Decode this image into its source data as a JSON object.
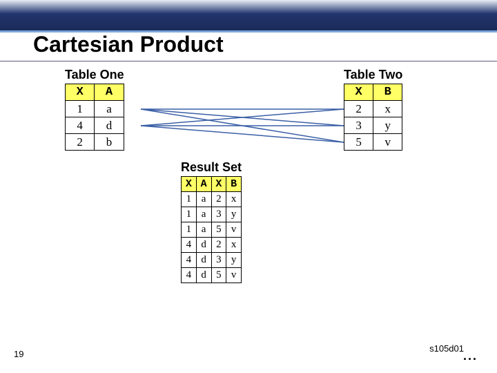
{
  "title": "Cartesian Product",
  "slide_number": "19",
  "code_id": "s105d01",
  "ellipsis": "...",
  "table_one": {
    "caption": "Table One",
    "headers": [
      "X",
      "A"
    ],
    "rows": [
      [
        "1",
        "a"
      ],
      [
        "4",
        "d"
      ],
      [
        "2",
        "b"
      ]
    ]
  },
  "table_two": {
    "caption": "Table Two",
    "headers": [
      "X",
      "B"
    ],
    "rows": [
      [
        "2",
        "x"
      ],
      [
        "3",
        "y"
      ],
      [
        "5",
        "v"
      ]
    ]
  },
  "result": {
    "caption": "Result Set",
    "headers": [
      "X",
      "A",
      "X",
      "B"
    ],
    "rows": [
      [
        "1",
        "a",
        "2",
        "x"
      ],
      [
        "1",
        "a",
        "3",
        "y"
      ],
      [
        "1",
        "a",
        "5",
        "v"
      ],
      [
        "4",
        "d",
        "2",
        "x"
      ],
      [
        "4",
        "d",
        "3",
        "y"
      ],
      [
        "4",
        "d",
        "5",
        "v"
      ]
    ]
  },
  "chart_data": [
    {
      "type": "table",
      "title": "Table One",
      "columns": [
        "X",
        "A"
      ],
      "rows": [
        [
          "1",
          "a"
        ],
        [
          "4",
          "d"
        ],
        [
          "2",
          "b"
        ]
      ]
    },
    {
      "type": "table",
      "title": "Table Two",
      "columns": [
        "X",
        "B"
      ],
      "rows": [
        [
          "2",
          "x"
        ],
        [
          "3",
          "y"
        ],
        [
          "5",
          "v"
        ]
      ]
    },
    {
      "type": "table",
      "title": "Result Set",
      "columns": [
        "X",
        "A",
        "X",
        "B"
      ],
      "rows": [
        [
          "1",
          "a",
          "2",
          "x"
        ],
        [
          "1",
          "a",
          "3",
          "y"
        ],
        [
          "1",
          "a",
          "5",
          "v"
        ],
        [
          "4",
          "d",
          "2",
          "x"
        ],
        [
          "4",
          "d",
          "3",
          "y"
        ],
        [
          "4",
          "d",
          "5",
          "v"
        ]
      ]
    }
  ]
}
